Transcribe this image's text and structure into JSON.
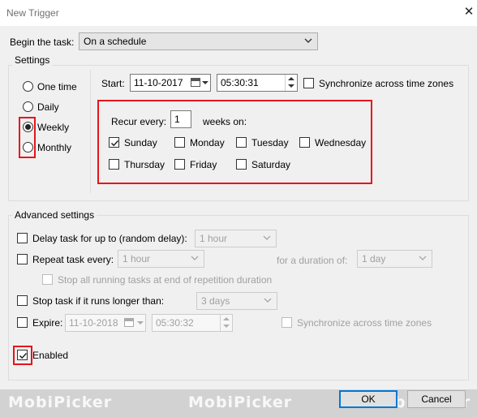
{
  "window": {
    "title": "New Trigger",
    "close_icon": "close-icon"
  },
  "begin_task": {
    "label": "Begin the task:",
    "value": "On a schedule"
  },
  "settings": {
    "group_label": "Settings",
    "schedule_types": [
      {
        "label": "One time",
        "selected": false
      },
      {
        "label": "Daily",
        "selected": false
      },
      {
        "label": "Weekly",
        "selected": true
      },
      {
        "label": "Monthly",
        "selected": false
      }
    ],
    "start_label": "Start:",
    "start_date": "11-10-2017",
    "start_time": "05:30:31",
    "sync_label": "Synchronize across time zones",
    "sync_checked": false,
    "recur_label": "Recur every:",
    "recur_value": "1",
    "weeks_on_label": "weeks on:",
    "days": [
      {
        "label": "Sunday",
        "checked": true
      },
      {
        "label": "Monday",
        "checked": false
      },
      {
        "label": "Tuesday",
        "checked": false
      },
      {
        "label": "Wednesday",
        "checked": false
      },
      {
        "label": "Thursday",
        "checked": false
      },
      {
        "label": "Friday",
        "checked": false
      },
      {
        "label": "Saturday",
        "checked": false
      }
    ]
  },
  "advanced": {
    "group_label": "Advanced settings",
    "delay_label": "Delay task for up to (random delay):",
    "delay_value": "1 hour",
    "repeat_label": "Repeat task every:",
    "repeat_value": "1 hour",
    "duration_label": "for a duration of:",
    "duration_value": "1 day",
    "stop_all_label": "Stop all running tasks at end of repetition duration",
    "stop_task_label": "Stop task if it runs longer than:",
    "stop_task_value": "3 days",
    "expire_label": "Expire:",
    "expire_date": "11-10-2018",
    "expire_time": "05:30:32",
    "expire_sync_label": "Synchronize across time zones",
    "enabled_label": "Enabled",
    "enabled_checked": true
  },
  "buttons": {
    "ok": "OK",
    "cancel": "Cancel"
  },
  "watermark": {
    "text": "MobiPicker"
  },
  "colors": {
    "highlight": "#e8141c",
    "default_button_border": "#0078d7"
  }
}
